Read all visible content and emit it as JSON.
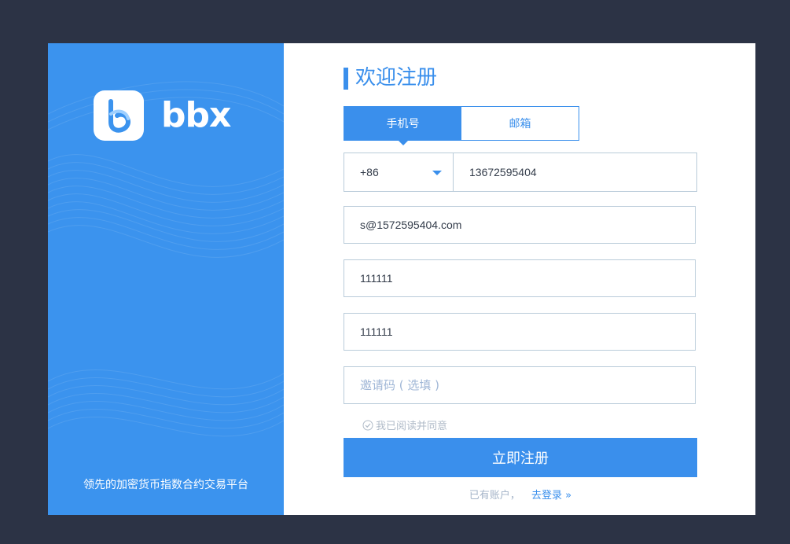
{
  "brand": {
    "name": "bbx",
    "slogan": "领先的加密货币指数合约交易平台",
    "logo_icon": "bbx-logo-icon"
  },
  "form": {
    "title": "欢迎注册",
    "tabs": [
      {
        "label": "手机号",
        "active": true
      },
      {
        "label": "邮箱",
        "active": false
      }
    ],
    "country_code": "+86",
    "phone_value": "13672595404",
    "email_value": "s@1572595404.com",
    "password_value": "111111",
    "confirm_password_value": "111111",
    "invite_placeholder": "邀请码 ( 选填 )",
    "agree_label": "我已阅读并同意",
    "submit_label": "立即注册",
    "have_account_text": "已有账户，",
    "login_link": "去登录 »"
  },
  "colors": {
    "background": "#2c3345",
    "accent": "#3a8fec",
    "panel_blue": "#3b93ee",
    "border": "#b9cbd9"
  }
}
